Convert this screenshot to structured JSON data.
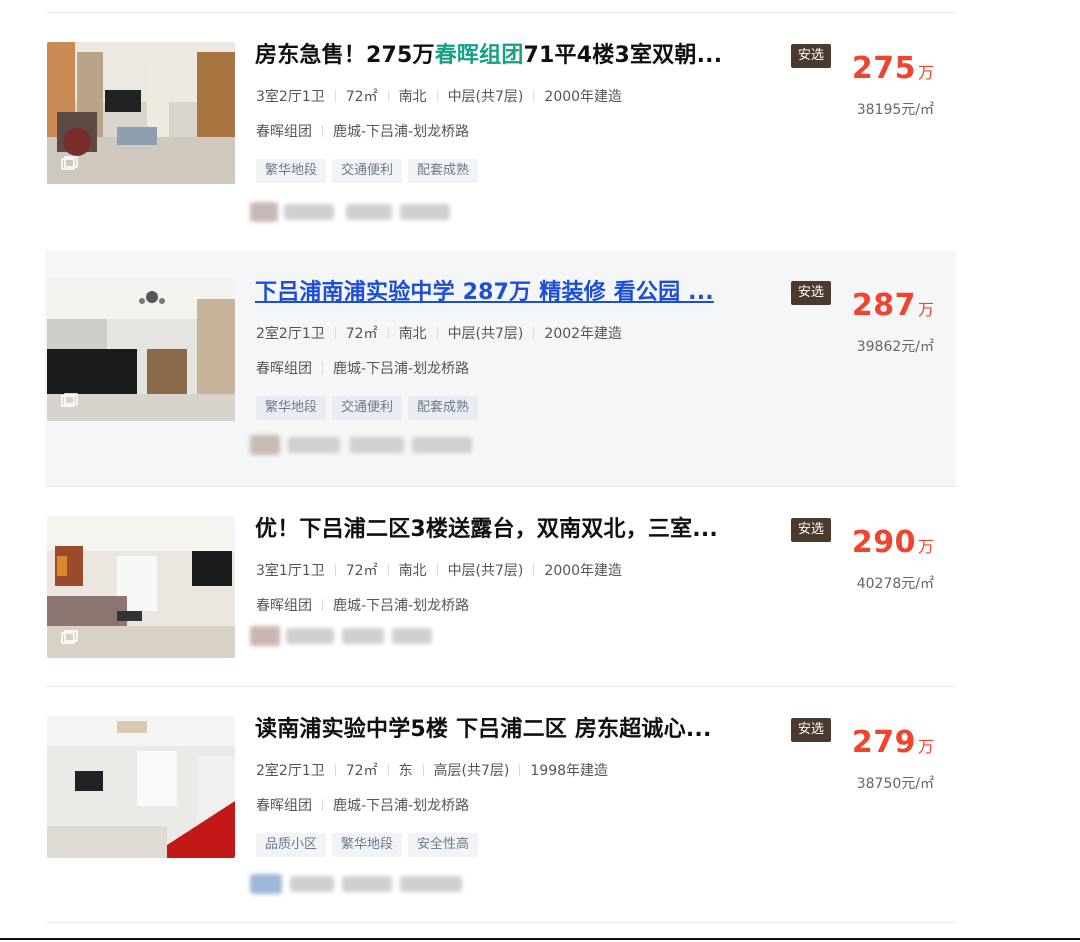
{
  "listings": [
    {
      "title_parts": [
        "房东急售！275万",
        "春晖组团",
        "71平4楼3室双朝..."
      ],
      "badge": "安选",
      "rooms": "3室2厅1卫",
      "area": "72㎡",
      "orientation": "南北",
      "floor": "中层(共7层)",
      "year": "2000年建造",
      "community": "春晖组团",
      "district": "鹿城-下吕浦-划龙桥路",
      "tags": [
        "繁华地段",
        "交通便利",
        "配套成熟"
      ],
      "price": "275",
      "price_unit": "万",
      "unit_price": "38195元/㎡"
    },
    {
      "title": "下吕浦南浦实验中学 287万 精装修 看公园 ...",
      "badge": "安选",
      "rooms": "2室2厅1卫",
      "area": "72㎡",
      "orientation": "南北",
      "floor": "中层(共7层)",
      "year": "2002年建造",
      "community": "春晖组团",
      "district": "鹿城-下吕浦-划龙桥路",
      "tags": [
        "繁华地段",
        "交通便利",
        "配套成熟"
      ],
      "price": "287",
      "price_unit": "万",
      "unit_price": "39862元/㎡"
    },
    {
      "title": "优！下吕浦二区3楼送露台，双南双北，三室...",
      "badge": "安选",
      "rooms": "3室1厅1卫",
      "area": "72㎡",
      "orientation": "南北",
      "floor": "中层(共7层)",
      "year": "2000年建造",
      "community": "春晖组团",
      "district": "鹿城-下吕浦-划龙桥路",
      "tags": [],
      "price": "290",
      "price_unit": "万",
      "unit_price": "40278元/㎡"
    },
    {
      "title": "读南浦实验中学5楼 下吕浦二区 房东超诚心...",
      "badge": "安选",
      "rooms": "2室2厅1卫",
      "area": "72㎡",
      "orientation": "东",
      "floor": "高层(共7层)",
      "year": "1998年建造",
      "community": "春晖组团",
      "district": "鹿城-下吕浦-划龙桥路",
      "tags": [
        "品质小区",
        "繁华地段",
        "安全性高"
      ],
      "price": "279",
      "price_unit": "万",
      "unit_price": "38750元/㎡"
    }
  ],
  "icons": {
    "photo_badge": "gallery-icon"
  },
  "colors": {
    "price": "#f0442f",
    "badge_bg": "#4b3b2f",
    "highlight": "#16a085",
    "link": "#1d4ed8",
    "tag_text": "#6b7a90"
  }
}
